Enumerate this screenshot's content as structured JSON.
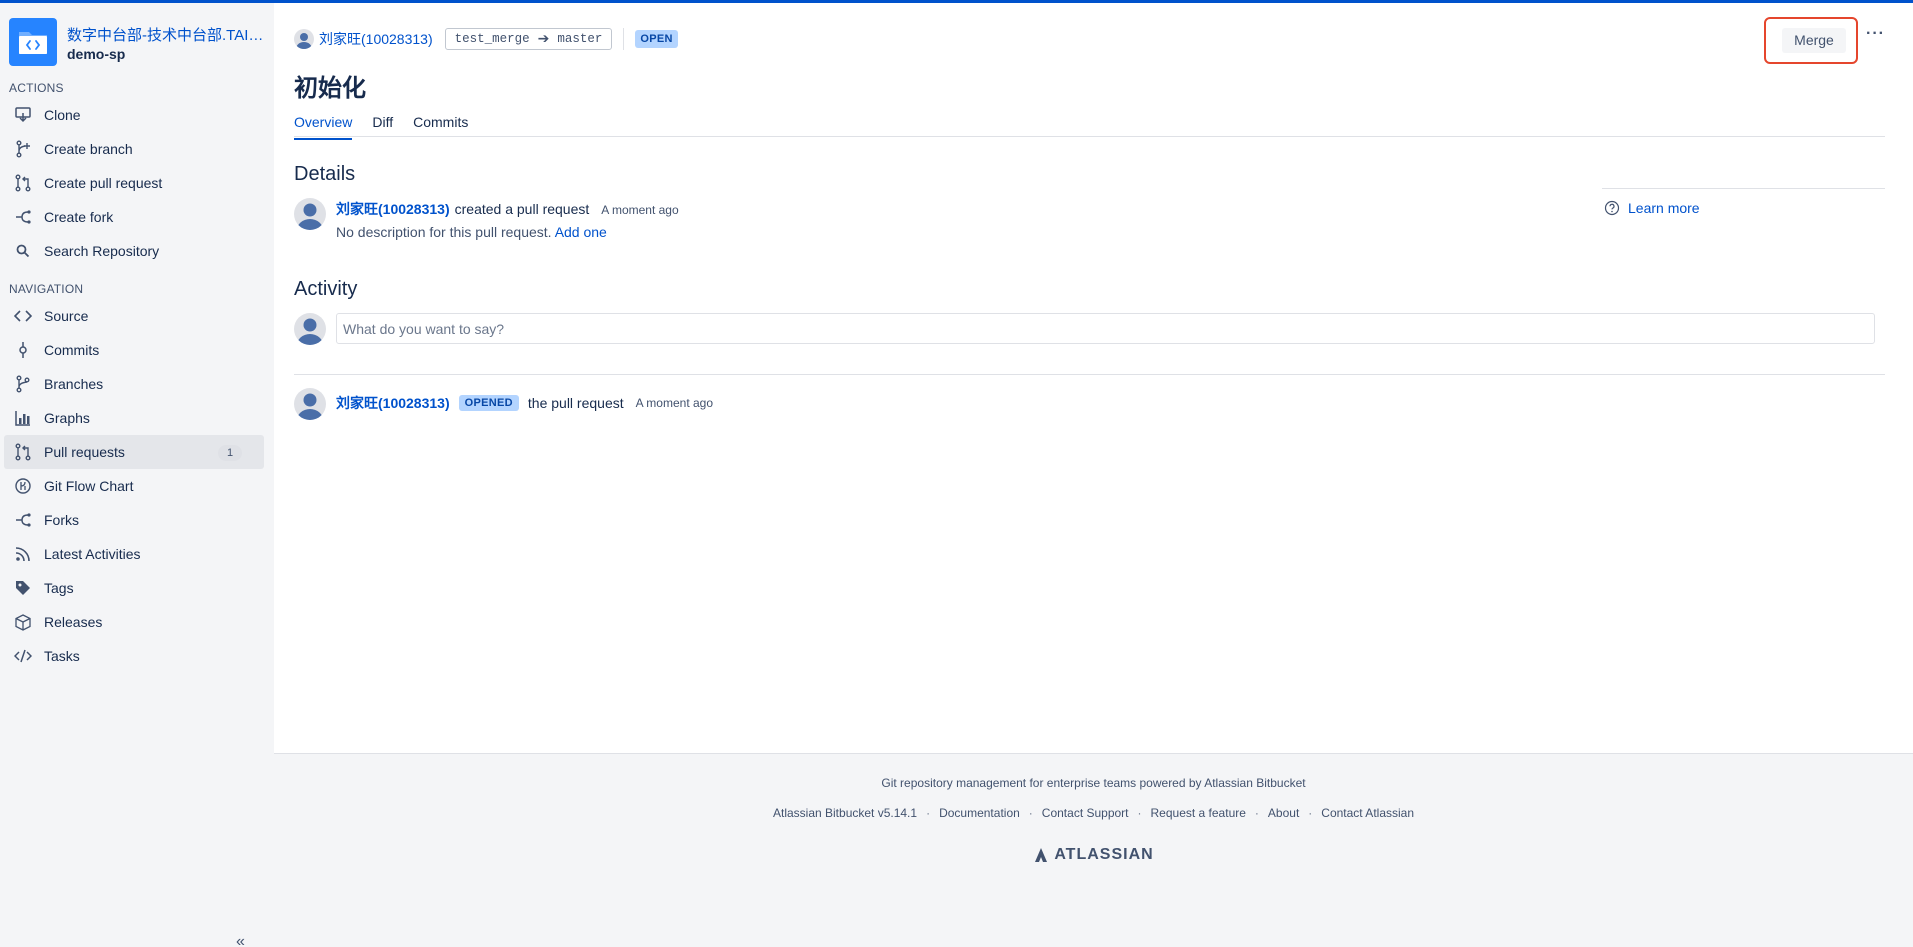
{
  "sidebar": {
    "project": "数字中台部-技术中台部.TAIR...",
    "repo": "demo-sp",
    "actions_title": "ACTIONS",
    "actions": [
      {
        "label": "Clone",
        "icon": "clone-icon"
      },
      {
        "label": "Create branch",
        "icon": "branch-icon"
      },
      {
        "label": "Create pull request",
        "icon": "pull-request-icon"
      },
      {
        "label": "Create fork",
        "icon": "fork-icon"
      },
      {
        "label": "Search Repository",
        "icon": "search-icon"
      }
    ],
    "navigation_title": "NAVIGATION",
    "navigation": [
      {
        "label": "Source",
        "icon": "source-icon"
      },
      {
        "label": "Commits",
        "icon": "commit-icon"
      },
      {
        "label": "Branches",
        "icon": "branches-icon"
      },
      {
        "label": "Graphs",
        "icon": "graph-icon"
      },
      {
        "label": "Pull requests",
        "icon": "pull-request-icon",
        "badge": "1",
        "active": true
      },
      {
        "label": "Git Flow Chart",
        "icon": "git-flow-icon"
      },
      {
        "label": "Forks",
        "icon": "fork-icon"
      },
      {
        "label": "Latest Activities",
        "icon": "rss-icon"
      },
      {
        "label": "Tags",
        "icon": "tag-icon"
      },
      {
        "label": "Releases",
        "icon": "box-icon"
      },
      {
        "label": "Tasks",
        "icon": "code-icon"
      }
    ],
    "collapse": "«"
  },
  "pr": {
    "author": "刘家旺(10028313)",
    "source_branch": "test_merge",
    "arrow": "➔",
    "target_branch": "master",
    "status": "OPEN",
    "merge_label": "Merge",
    "more_label": "···",
    "title": "初始化",
    "tabs": [
      "Overview",
      "Diff",
      "Commits"
    ]
  },
  "details": {
    "heading": "Details",
    "author": "刘家旺(10028313)",
    "action": "created a pull request",
    "time": "A moment ago",
    "description": "No description for this pull request.",
    "add_one": "Add one",
    "learn_more": "Learn more"
  },
  "activity": {
    "heading": "Activity",
    "placeholder": "What do you want to say?",
    "author": "刘家旺(10028313)",
    "badge": "OPENED",
    "text": "the pull request",
    "time": "A moment ago"
  },
  "footer": {
    "tagline": "Git repository management for enterprise teams powered by Atlassian Bitbucket",
    "links": [
      "Atlassian Bitbucket v5.14.1",
      "Documentation",
      "Contact Support",
      "Request a feature",
      "About",
      "Contact Atlassian"
    ],
    "separator": "·",
    "brand": "ATLASSIAN"
  },
  "colors": {
    "accent": "#0052cc",
    "highlight_border": "#e5462d",
    "sidebar_bg": "#f4f5f7"
  }
}
